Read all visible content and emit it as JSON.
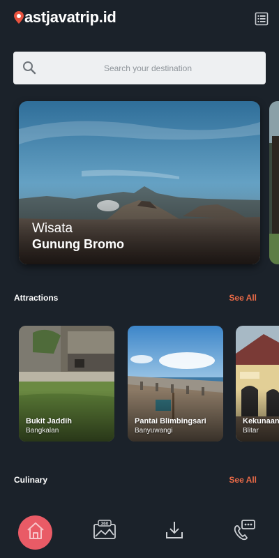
{
  "header": {
    "logo_text": "astjavatrip.id",
    "logo_letter": "e",
    "menu_icon": "list-menu-icon"
  },
  "search": {
    "placeholder": "Search your destination",
    "icon": "search-icon"
  },
  "hero": {
    "line1": "Wisata",
    "line2": "Gunung Bromo"
  },
  "attractions": {
    "title": "Attractions",
    "see_all": "See All",
    "cards": [
      {
        "name": "Bukit Jaddih",
        "location": "Bangkalan"
      },
      {
        "name": "Pantai Blimbingsari",
        "location": "Banyuwangi"
      },
      {
        "name": "Kekunaan",
        "location": "Blitar"
      }
    ]
  },
  "culinary": {
    "title": "Culinary",
    "see_all": "See All"
  },
  "bottom_nav": {
    "items": [
      "home-icon",
      "view-360-icon",
      "download-icon",
      "contact-chat-icon"
    ],
    "active": "home-icon"
  },
  "colors": {
    "background": "#1b222a",
    "accent": "#ea6a47",
    "home_active": "#e95b66",
    "search_bg": "#eef0f2"
  }
}
